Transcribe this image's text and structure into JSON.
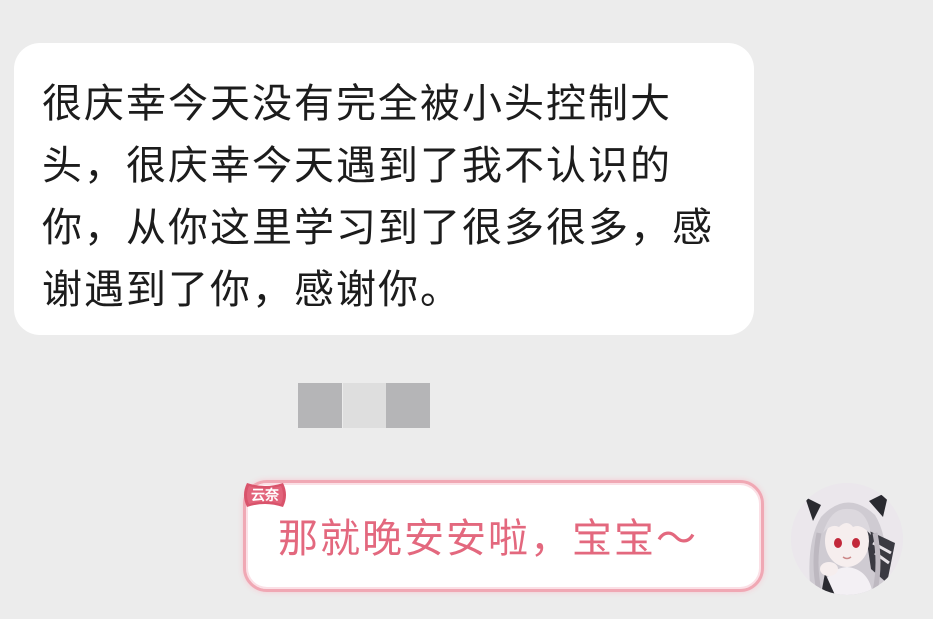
{
  "messages": {
    "incoming": {
      "text": "很庆幸今天没有完全被小头控制大头，很庆幸今天遇到了我不认识的你，从你这里学习到了很多很多，感谢遇到了你，感谢你。"
    },
    "outgoing": {
      "text": "那就晚安安啦，宝宝～",
      "nickname": "云奈",
      "accent_color": "#e3687e",
      "border_color": "#f0a8b4"
    }
  },
  "icons": {
    "avatar": "anime-girl-avatar",
    "tag": "bow-nickname-tag"
  }
}
